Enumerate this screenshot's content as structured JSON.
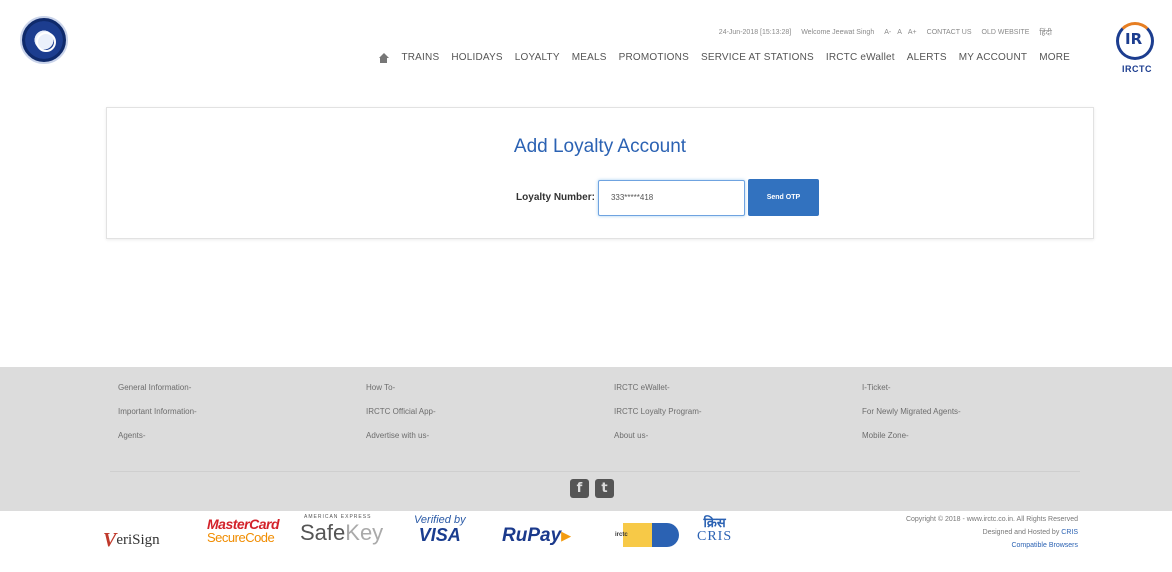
{
  "header": {
    "datetime": "24-Jun-2018 [15:13:28]",
    "welcome": "Welcome Jeewat Singh",
    "font_controls": [
      "A-",
      "A",
      "A+"
    ],
    "contact_us": "CONTACT US",
    "old_website": "OLD WEBSITE",
    "hindi": "हिंदी",
    "right_logo_text": "IRCTC",
    "nav": {
      "trains": "TRAINS",
      "holidays": "HOLIDAYS",
      "loyalty": "LOYALTY",
      "meals": "MEALS",
      "promotions": "PROMOTIONS",
      "service_at_stations": "SERVICE AT STATIONS",
      "ewallet": "IRCTC eWallet",
      "alerts": "ALERTS",
      "my_account": "MY ACCOUNT",
      "more": "MORE"
    }
  },
  "main": {
    "title": "Add Loyalty Account",
    "loyalty_label": "Loyalty Number:",
    "loyalty_value": "333*****418",
    "send_otp_label": "Send OTP"
  },
  "footer": {
    "links": [
      "General Information-",
      "How To-",
      "IRCTC eWallet-",
      "I-Ticket-",
      "Important Information-",
      "IRCTC Official App-",
      "IRCTC Loyalty Program-",
      "For Newly Migrated Agents-",
      "Agents-",
      "Advertise with us-",
      "About us-",
      "Mobile Zone-"
    ],
    "social": {
      "facebook": "f",
      "twitter": "t"
    },
    "copyright_line1": "Copyright © 2018 - www.irctc.co.in. All Rights Reserved",
    "copyright_line2_prefix": "Designed and Hosted by ",
    "copyright_line2_link": "CRIS",
    "compatible": "Compatible Browsers"
  },
  "badges": {
    "verisign_v": "V",
    "verisign_rest": "eriSign",
    "mastercard_1": "MasterCard",
    "mastercard_2": "SecureCode",
    "amex": "AMERICAN EXPRESS",
    "safekey_1": "Safe",
    "safekey_2": "Key",
    "visa_1": "Verified by",
    "visa_2": "VISA",
    "rupay": "RuPay",
    "irctc": "irctc",
    "cris_hindi": "क्रिस",
    "cris_en": "CRIS"
  }
}
